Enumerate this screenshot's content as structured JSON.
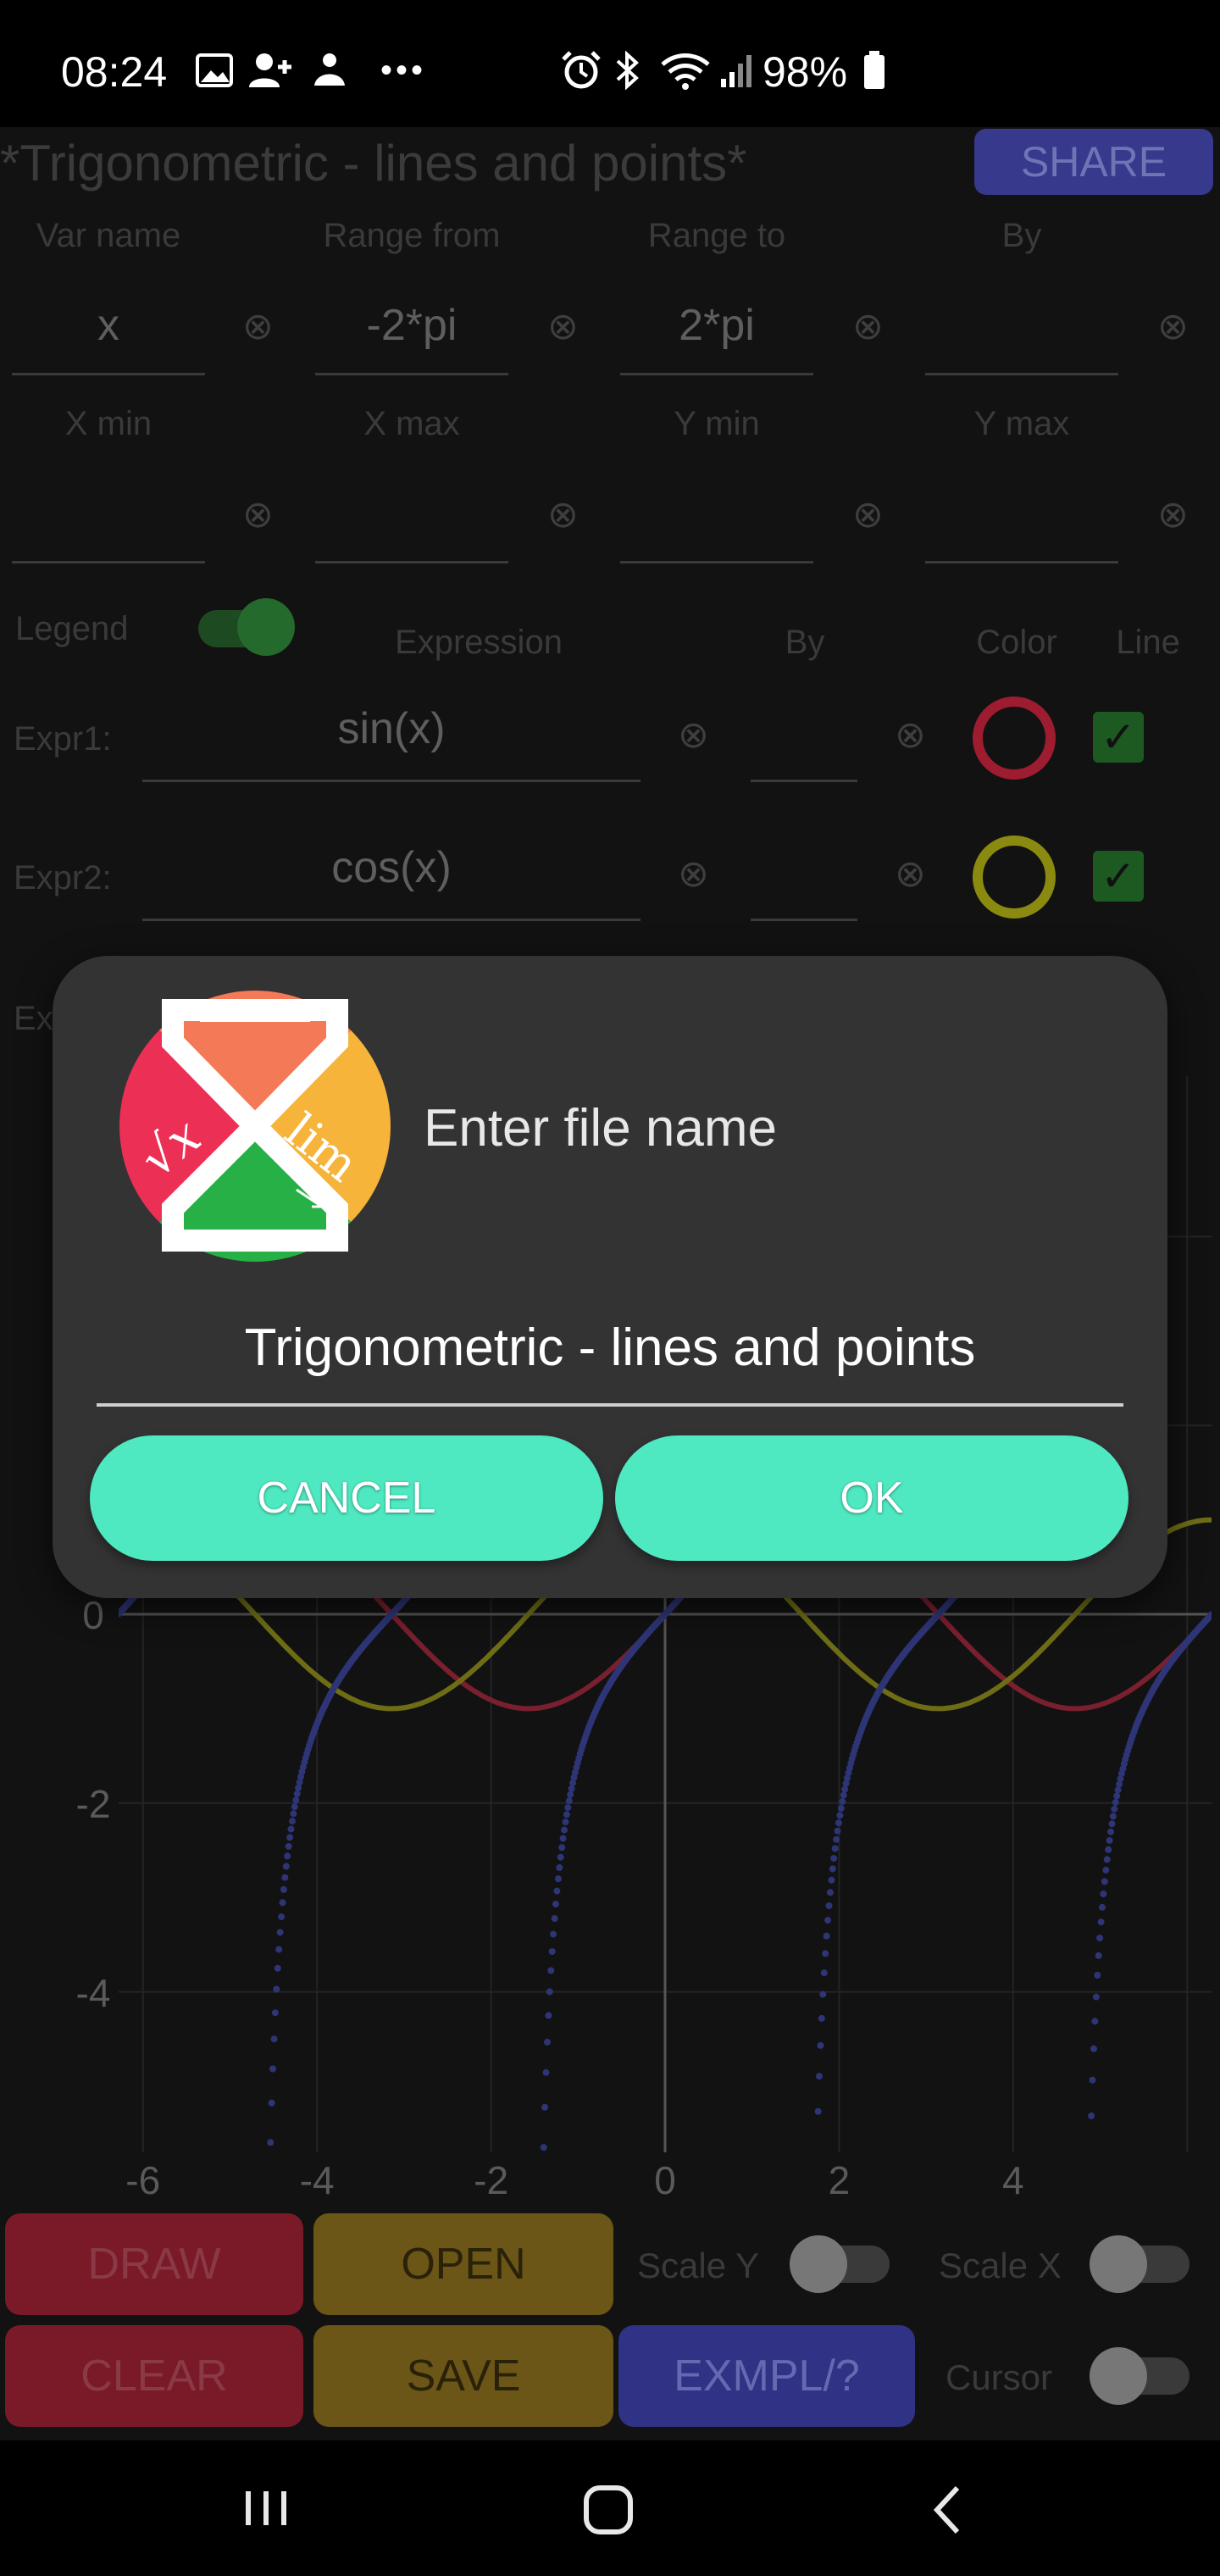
{
  "status": {
    "time": "08:24",
    "battery": "98%"
  },
  "app": {
    "title": "*Trigonometric - lines and points*",
    "share_label": "SHARE",
    "range_headers": [
      "Var name",
      "Range from",
      "Range to",
      "By"
    ],
    "range_values": [
      "x",
      "-2*pi",
      "2*pi",
      ""
    ],
    "limit_headers": [
      "X min",
      "X max",
      "Y min",
      "Y max"
    ],
    "limit_values": [
      "",
      "",
      "",
      ""
    ],
    "legend_label": "Legend",
    "expr_header": "Expression",
    "by_header": "By",
    "color_header": "Color",
    "line_header": "Line",
    "expressions": [
      {
        "label": "Expr1:",
        "value": "sin(x)",
        "by": "",
        "color": "#9e1c30",
        "line": true
      },
      {
        "label": "Expr2:",
        "value": "cos(x)",
        "by": "",
        "color": "#8b8a10",
        "line": true
      }
    ],
    "expr3_label_partial": "Ex",
    "clear_symbol": "⊗"
  },
  "chart_data": {
    "type": "line",
    "xlim": [
      -6.28,
      6.28
    ],
    "ylim": [
      -5.7,
      5.7
    ],
    "x_ticks": [
      "-6",
      "-4",
      "-2",
      "0",
      "2",
      "4"
    ],
    "y_ticks": [
      "0",
      "-2",
      "-4"
    ],
    "series": [
      {
        "expr": "sin(x)",
        "color": "#7a1f2e",
        "style": "line"
      },
      {
        "expr": "cos(x)",
        "color": "#6e6d16",
        "style": "line"
      },
      {
        "expr": "tan(x)",
        "color": "#2e3576",
        "style": "points"
      }
    ]
  },
  "bottom": {
    "draw": "DRAW",
    "open": "OPEN",
    "clear": "CLEAR",
    "save": "SAVE",
    "exmpl": "EXMPL/?",
    "scale_y": "Scale Y",
    "scale_x": "Scale X",
    "cursor": "Cursor"
  },
  "dialog": {
    "title": "Enter file name",
    "input_value": "Trigonometric - lines and points",
    "cancel_label": "CANCEL",
    "ok_label": "OK"
  }
}
